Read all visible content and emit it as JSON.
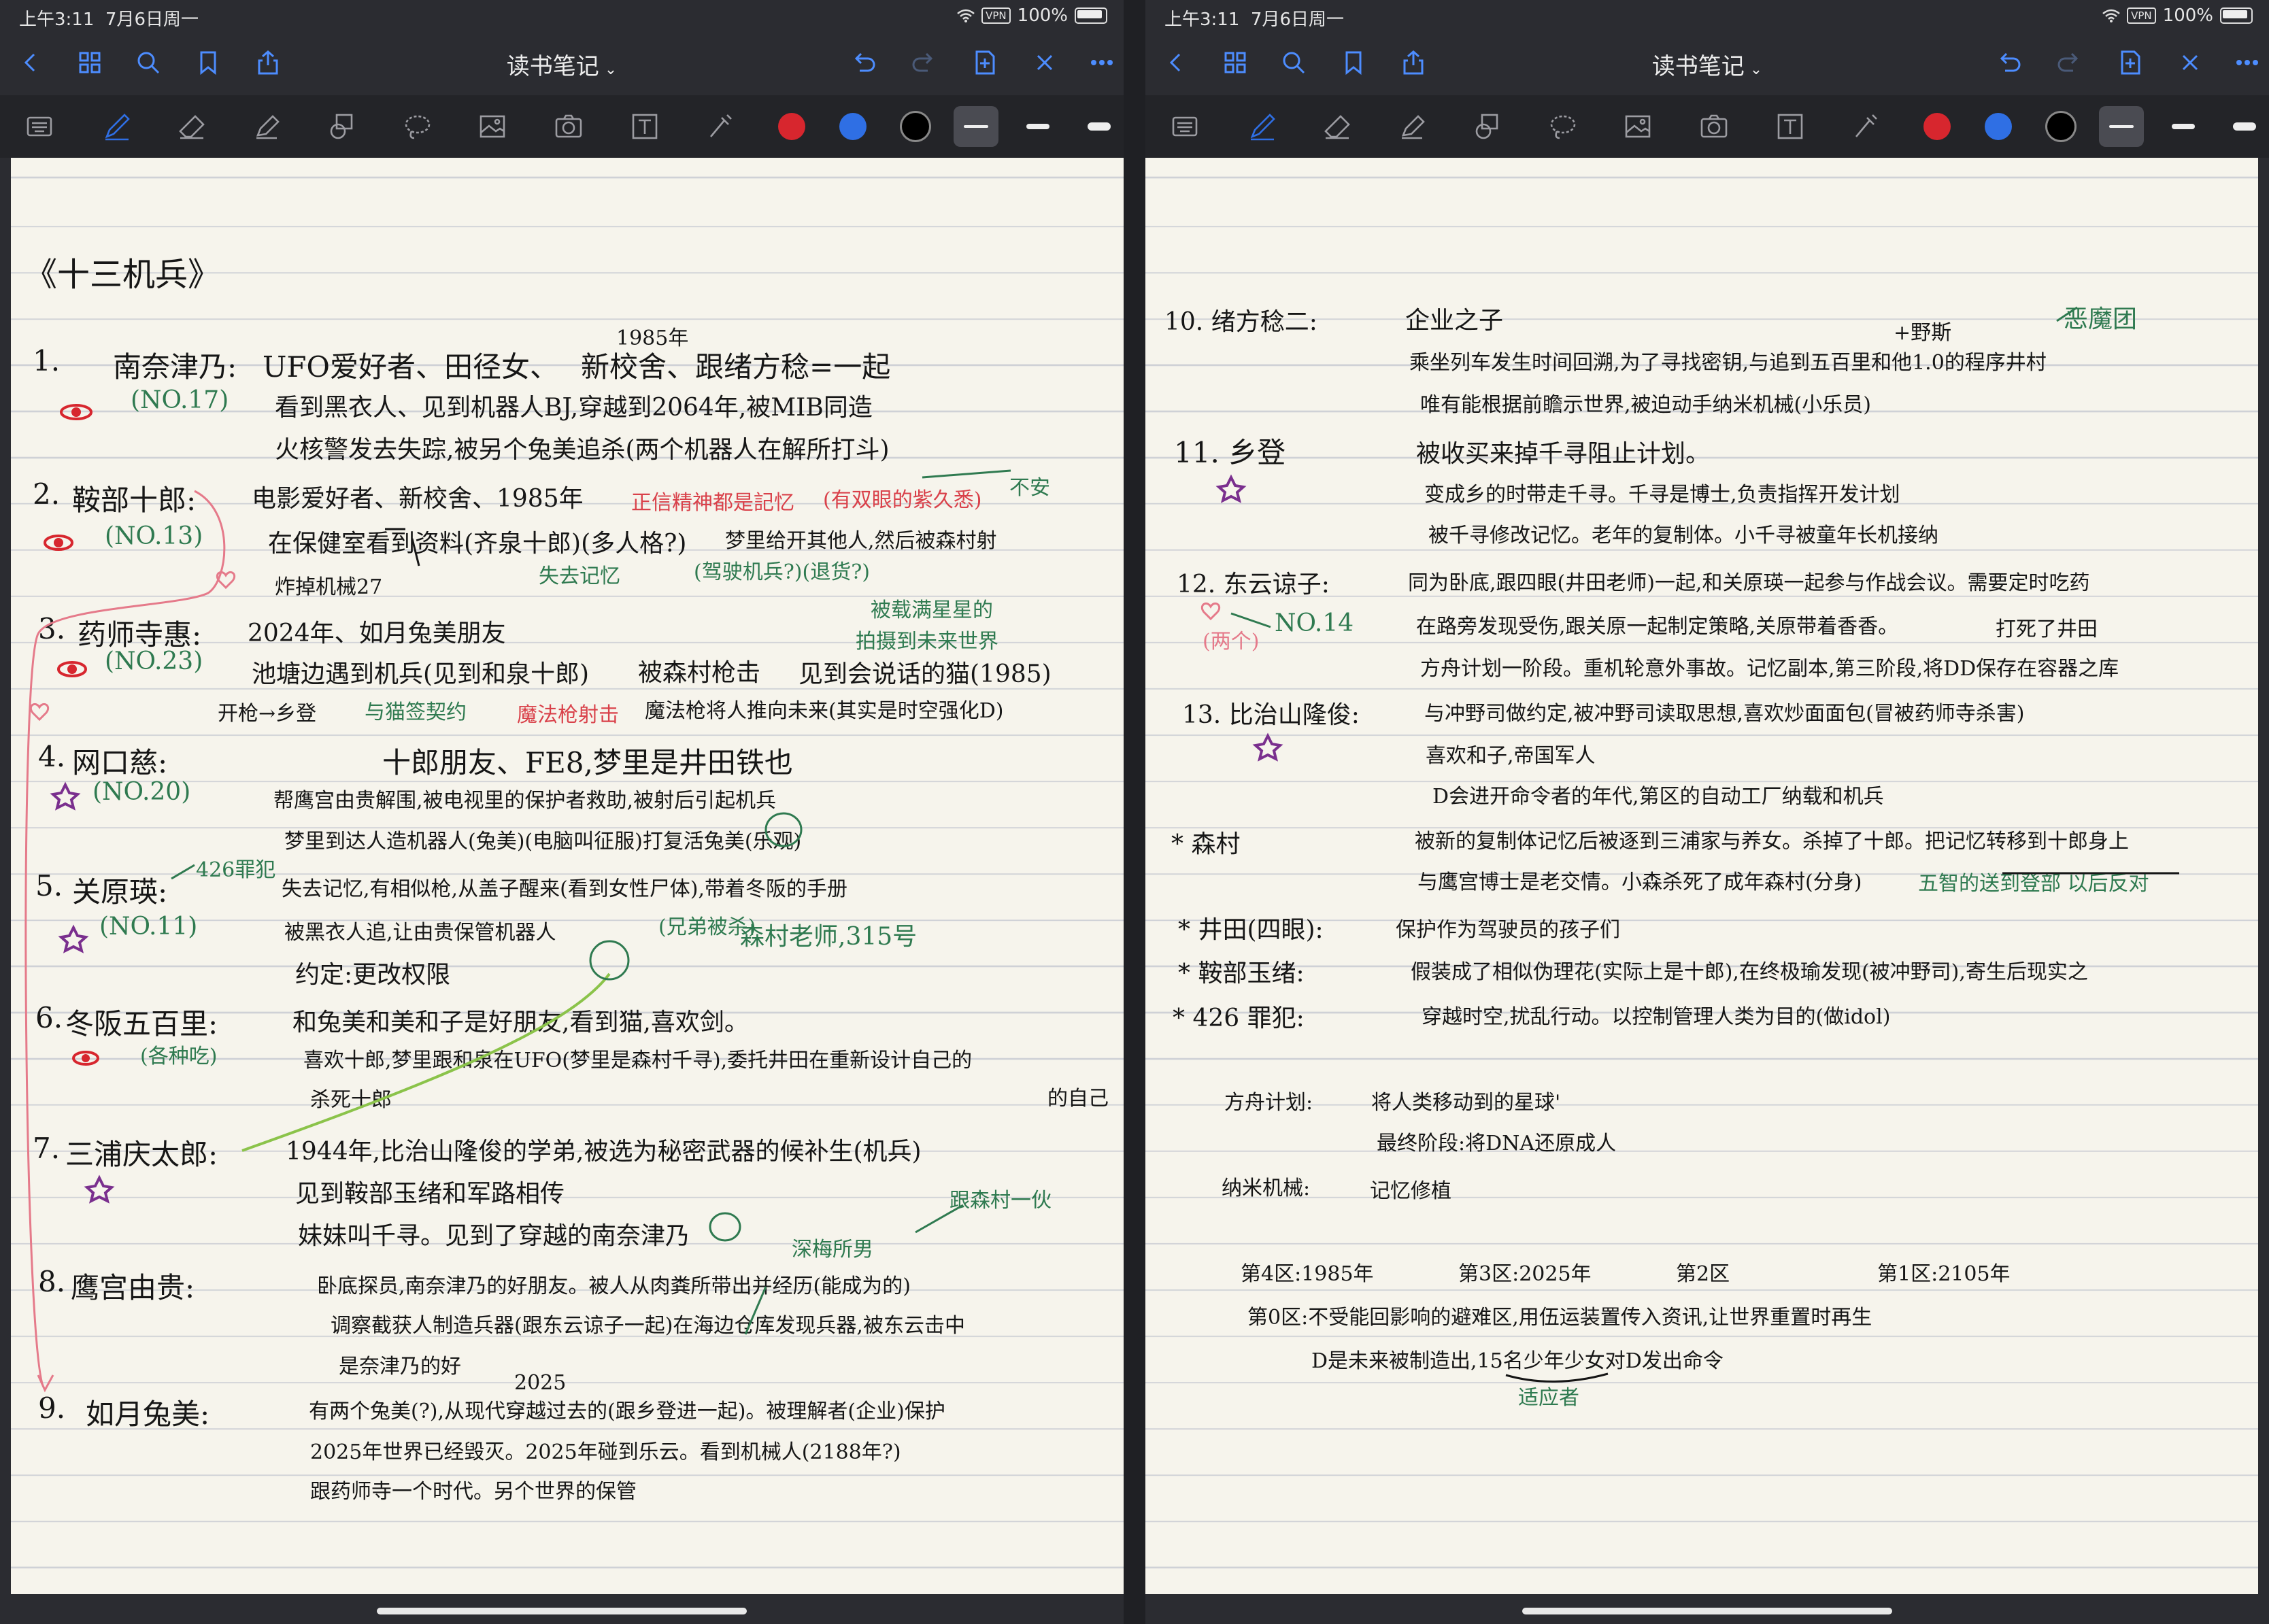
{
  "status": {
    "time": "上午3:11",
    "date": "7月6日周一",
    "vpn": "VPN",
    "battery": "100%"
  },
  "app": {
    "title": "读书笔记"
  },
  "nav_icons": [
    "back-icon",
    "grid-icon",
    "search-icon",
    "bookmark-icon",
    "share-icon",
    "undo-icon",
    "redo-icon",
    "add-page-icon",
    "close-icon",
    "more-icon"
  ],
  "tools": [
    "keyboard-icon",
    "pen-icon",
    "eraser-icon",
    "highlighter-icon",
    "shapes-icon",
    "lasso-icon",
    "image-icon",
    "camera-icon",
    "text-icon",
    "laser-icon"
  ],
  "colors": {
    "red": "#d7262e",
    "blue": "#2f6fe4",
    "black": "#000000",
    "accent": "#4d8dff"
  },
  "left_page": {
    "heading": "《十三机兵》",
    "lines": [
      {
        "t": "1.",
        "c": "black"
      },
      {
        "t": "南奈津乃:",
        "c": "black"
      },
      {
        "t": "UFO爱好者、田径女、",
        "c": "black"
      },
      {
        "t": "1985年",
        "c": "black"
      },
      {
        "t": "新校舍、跟绪方稔=一起",
        "c": "black"
      },
      {
        "t": "(NO.17)",
        "c": "green"
      },
      {
        "t": "看到黑衣人、见到机器人BJ,穿越到2064年,被MIB同造",
        "c": "black"
      },
      {
        "t": "火核警发去失踪,被另个兔美追杀(两个机器人在解所打斗)",
        "c": "black"
      },
      {
        "t": "2.",
        "c": "black"
      },
      {
        "t": "鞍部十郎:",
        "c": "black"
      },
      {
        "t": "电影爱好者、新校舍、1985年",
        "c": "black"
      },
      {
        "t": "正信精神都是記忆",
        "c": "red"
      },
      {
        "t": "(有双眼的紫久悉)",
        "c": "red"
      },
      {
        "t": "不安",
        "c": "green"
      },
      {
        "t": "(NO.13)",
        "c": "green"
      },
      {
        "t": "在保健室看到资料(齐泉十郎)(多人格?)",
        "c": "black"
      },
      {
        "t": "梦里给开其他人,然后被森村射",
        "c": "black"
      },
      {
        "t": "炸掉机械27",
        "c": "black"
      },
      {
        "t": "失去记忆",
        "c": "green"
      },
      {
        "t": "(驾驶机兵?)(退货?)",
        "c": "green"
      },
      {
        "t": "3.",
        "c": "black"
      },
      {
        "t": "药师寺惠:",
        "c": "black"
      },
      {
        "t": "2024年、如月兔美朋友",
        "c": "black"
      },
      {
        "t": "被载满星星的",
        "c": "green"
      },
      {
        "t": "拍摄到未来世界",
        "c": "green"
      },
      {
        "t": "(NO.23)",
        "c": "green"
      },
      {
        "t": "池塘边遇到机兵(见到和泉十郎)",
        "c": "black"
      },
      {
        "t": "被森村枪击",
        "c": "black"
      },
      {
        "t": "见到会说话的猫(1985)",
        "c": "black"
      },
      {
        "t": "开枪→乡登",
        "c": "black"
      },
      {
        "t": "与猫签契约",
        "c": "green"
      },
      {
        "t": "魔法枪射击",
        "c": "red"
      },
      {
        "t": "魔法枪将人推向未来(其实是时空强化D)",
        "c": "black"
      },
      {
        "t": "4.",
        "c": "black"
      },
      {
        "t": "网口慈:",
        "c": "black"
      },
      {
        "t": "十郎朋友、FE8,梦里是井田铁也",
        "c": "black"
      },
      {
        "t": "(NO.20)",
        "c": "green"
      },
      {
        "t": "帮鹰宫由贵解围,被电视里的保护者救助,被射后引起机兵",
        "c": "black"
      },
      {
        "t": "梦里到达人造机器人(兔美)(电脑叫征服)打复活兔美(乐观)",
        "c": "black"
      },
      {
        "t": "5.",
        "c": "black"
      },
      {
        "t": "关原瑛:",
        "c": "black"
      },
      {
        "t": "426罪犯",
        "c": "green"
      },
      {
        "t": "(NO.11)",
        "c": "green"
      },
      {
        "t": "失去记忆,有相似枪,从盖子醒来(看到女性尸体),带着冬阪的手册",
        "c": "black"
      },
      {
        "t": "被黑衣人追,让由贵保管机器人",
        "c": "black"
      },
      {
        "t": "(兄弟被杀)",
        "c": "green"
      },
      {
        "t": "森村老师,315号",
        "c": "green"
      },
      {
        "t": "约定:更改权限",
        "c": "black"
      },
      {
        "t": "6.",
        "c": "black"
      },
      {
        "t": "冬阪五百里:",
        "c": "black"
      },
      {
        "t": "(各种吃)",
        "c": "green"
      },
      {
        "t": "和兔美和美和子是好朋友,看到猫,喜欢剑。",
        "c": "black"
      },
      {
        "t": "喜欢十郎,梦里跟和泉在UFO(梦里是森村千寻),委托井田在重新设计自己的",
        "c": "black"
      },
      {
        "t": "杀死十郎",
        "c": "black"
      },
      {
        "t": "的自己",
        "c": "black"
      },
      {
        "t": "7.",
        "c": "black"
      },
      {
        "t": "三浦庆太郎:",
        "c": "black"
      },
      {
        "t": "1944年,比治山隆俊的学弟,被选为秘密武器的候补生(机兵)",
        "c": "black"
      },
      {
        "t": "见到鞍部玉绪和军路相传",
        "c": "black"
      },
      {
        "t": "妹妹叫千寻。见到了穿越的南奈津乃",
        "c": "black"
      },
      {
        "t": "跟森村一伙",
        "c": "green"
      },
      {
        "t": "深梅所男",
        "c": "green"
      },
      {
        "t": "8.",
        "c": "black"
      },
      {
        "t": "鹰宫由贵:",
        "c": "black"
      },
      {
        "t": "卧底探员,南奈津乃的好朋友。被人从肉粪所带出并经历(能成为的)",
        "c": "black"
      },
      {
        "t": "调察截获人制造兵器(跟东云谅子一起)在海边仓库发现兵器,被东云击中",
        "c": "black"
      },
      {
        "t": "是奈津乃的好",
        "c": "black"
      },
      {
        "t": "9.",
        "c": "black"
      },
      {
        "t": "如月兔美:",
        "c": "black"
      },
      {
        "t": "2025",
        "c": "black"
      },
      {
        "t": "有两个兔美(?),从现代穿越过去的(跟乡登进一起)。被理解者(企业)保护",
        "c": "black"
      },
      {
        "t": "2025年世界已经毁灭。2025年碰到乐云。看到机械人(2188年?)",
        "c": "black"
      },
      {
        "t": "跟药师寺一个时代。另个世界的保管",
        "c": "black"
      }
    ]
  },
  "right_page": {
    "lines": [
      {
        "t": "10. 绪方稔二:",
        "c": "black"
      },
      {
        "t": "企业之子",
        "c": "black"
      },
      {
        "t": "恶魔团",
        "c": "green"
      },
      {
        "t": "+野斯",
        "c": "black"
      },
      {
        "t": "乘坐列车发生时间回溯,为了寻找密钥,与追到五百里和他1.0的程序井村",
        "c": "black"
      },
      {
        "t": "唯有能根据前瞻示世界,被迫动手纳米机械(小乐员)",
        "c": "black"
      },
      {
        "t": "11. 乡登",
        "c": "black"
      },
      {
        "t": "被收买来掉千寻阻止计划。",
        "c": "black"
      },
      {
        "t": "变成乡的时带走千寻。千寻是博士,负责指挥开发计划",
        "c": "black"
      },
      {
        "t": "被千寻修改记忆。老年的复制体。小千寻被童年长机接纳",
        "c": "black"
      },
      {
        "t": "12. 东云谅子:",
        "c": "black"
      },
      {
        "t": "同为卧底,跟四眼(井田老师)一起,和关原瑛一起参与作战会议。需要定时吃药",
        "c": "black"
      },
      {
        "t": "NO.14",
        "c": "green"
      },
      {
        "t": "(两个)",
        "c": "pink"
      },
      {
        "t": "在路旁发现受伤,跟关原一起制定策略,关原带着香香。",
        "c": "black"
      },
      {
        "t": "打死了井田",
        "c": "black"
      },
      {
        "t": "方舟计划一阶段。重机轮意外事故。记忆副本,第三阶段,将DD保存在容器之库",
        "c": "black"
      },
      {
        "t": "13. 比治山隆俊:",
        "c": "black"
      },
      {
        "t": "与冲野司做约定,被冲野司读取思想,喜欢炒面面包(冒被药师寺杀害)",
        "c": "black"
      },
      {
        "t": "喜欢和子,帝国军人",
        "c": "black"
      },
      {
        "t": "D会进开命令者的年代,第区的自动工厂纳载和机兵",
        "c": "black"
      },
      {
        "t": "* 森村",
        "c": "black"
      },
      {
        "t": "被新的复制体记忆后被逐到三浦家与养女。杀掉了十郎。把记忆转移到十郎身上",
        "c": "black"
      },
      {
        "t": "与鹰宫博士是老交情。小森杀死了成年森村(分身)",
        "c": "black"
      },
      {
        "t": "五智的送到登部 以后反对",
        "c": "green"
      },
      {
        "t": "* 井田(四眼):",
        "c": "black"
      },
      {
        "t": "保护作为驾驶员的孩子们",
        "c": "black"
      },
      {
        "t": "* 鞍部玉绪:",
        "c": "black"
      },
      {
        "t": "假装成了相似伪理花(实际上是十郎),在终极瑜发现(被冲野司),寄生后现实之",
        "c": "black"
      },
      {
        "t": "* 426 罪犯:",
        "c": "black"
      },
      {
        "t": "穿越时空,扰乱行动。以控制管理人类为目的(做idol)",
        "c": "black"
      },
      {
        "t": "方舟计划:",
        "c": "black"
      },
      {
        "t": "将人类移动到的星球'",
        "c": "black"
      },
      {
        "t": "最终阶段:将DNA还原成人",
        "c": "black"
      },
      {
        "t": "纳米机械:",
        "c": "black"
      },
      {
        "t": "记忆修植",
        "c": "black"
      },
      {
        "t": "第4区:1985年",
        "c": "black"
      },
      {
        "t": "第3区:2025年",
        "c": "black"
      },
      {
        "t": "第2区",
        "c": "black"
      },
      {
        "t": "第1区:2105年",
        "c": "black"
      },
      {
        "t": "第0区:不受能回影响的避难区,用伍运装置传入资讯,让世界重置时再生",
        "c": "black"
      },
      {
        "t": "D是未来被制造出,15名少年少女对D发出命令",
        "c": "black"
      },
      {
        "t": "适应者",
        "c": "green"
      }
    ]
  }
}
